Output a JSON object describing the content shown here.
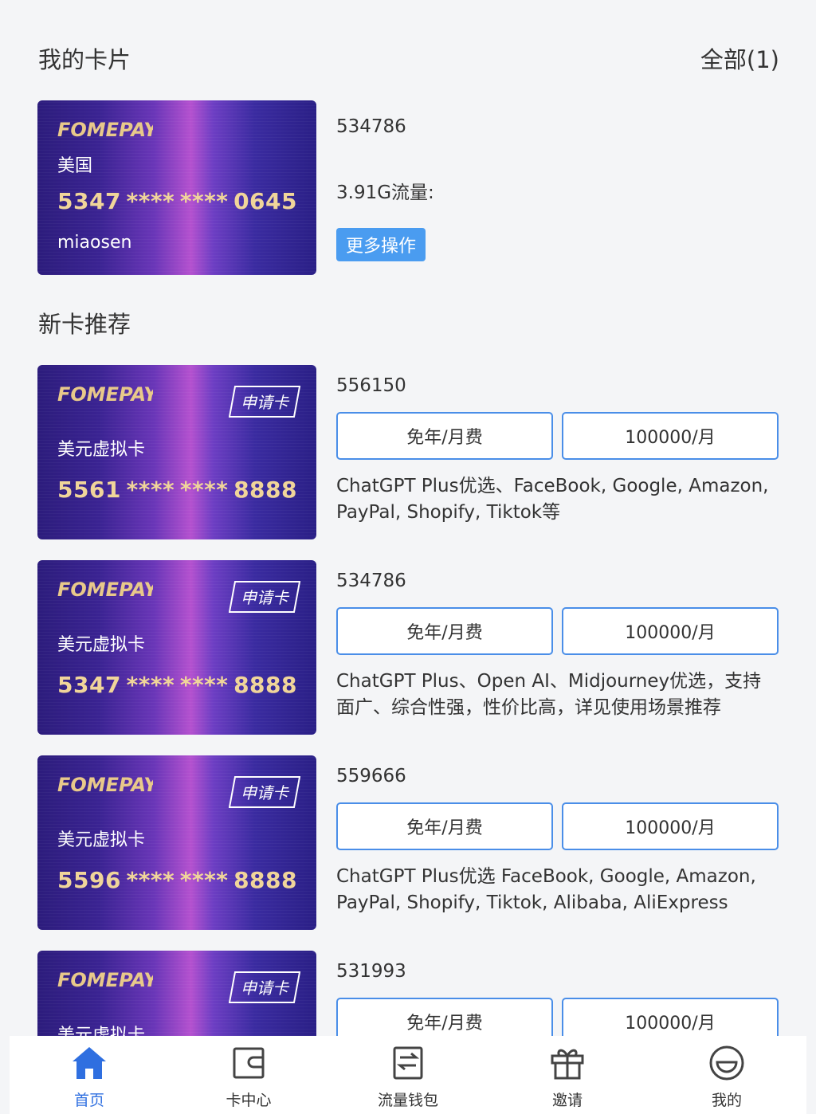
{
  "header": {
    "title": "我的卡片",
    "filter": "全部(1)"
  },
  "my_card": {
    "brand": "FOMEPAY",
    "country": "美国",
    "number": [
      "5347",
      "****",
      "****",
      "0645"
    ],
    "holder": "miaosen",
    "bin": "534786",
    "traffic": "3.91G流量:",
    "more_label": "更多操作"
  },
  "recommend": {
    "title": "新卡推荐",
    "apply_label": "申请卡",
    "items": [
      {
        "name": "美元虚拟卡",
        "number": [
          "5561",
          "****",
          "****",
          "8888"
        ],
        "bin": "556150",
        "fee": "免年/月费",
        "limit": "100000/月",
        "desc": "ChatGPT Plus优选、FaceBook, Google, Amazon, PayPal, Shopify, Tiktok等"
      },
      {
        "name": "美元虚拟卡",
        "number": [
          "5347",
          "****",
          "****",
          "8888"
        ],
        "bin": "534786",
        "fee": "免年/月费",
        "limit": "100000/月",
        "desc": "ChatGPT Plus、Open AI、Midjourney优选，支持面广、综合性强，性价比高，详见使用场景推荐"
      },
      {
        "name": "美元虚拟卡",
        "number": [
          "5596",
          "****",
          "****",
          "8888"
        ],
        "bin": "559666",
        "fee": "免年/月费",
        "limit": "100000/月",
        "desc": "ChatGPT Plus优选 FaceBook, Google, Amazon, PayPal, Shopify, Tiktok, Alibaba, AliExpress"
      },
      {
        "name": "美元虚拟卡",
        "number": [
          "",
          "",
          "",
          ""
        ],
        "bin": "531993",
        "fee": "免年/月费",
        "limit": "100000/月",
        "desc": ""
      }
    ]
  },
  "tabbar": [
    {
      "label": "首页",
      "icon": "home-icon",
      "active": true
    },
    {
      "label": "卡中心",
      "icon": "card-center-icon",
      "active": false
    },
    {
      "label": "流量钱包",
      "icon": "wallet-icon",
      "active": false
    },
    {
      "label": "邀请",
      "icon": "gift-icon",
      "active": false
    },
    {
      "label": "我的",
      "icon": "profile-icon",
      "active": false
    }
  ],
  "colors": {
    "accent": "#2f6fe0",
    "button_border": "#4a8ee8",
    "card_number": "#f0d59a",
    "more_button": "#4a9cf0"
  }
}
